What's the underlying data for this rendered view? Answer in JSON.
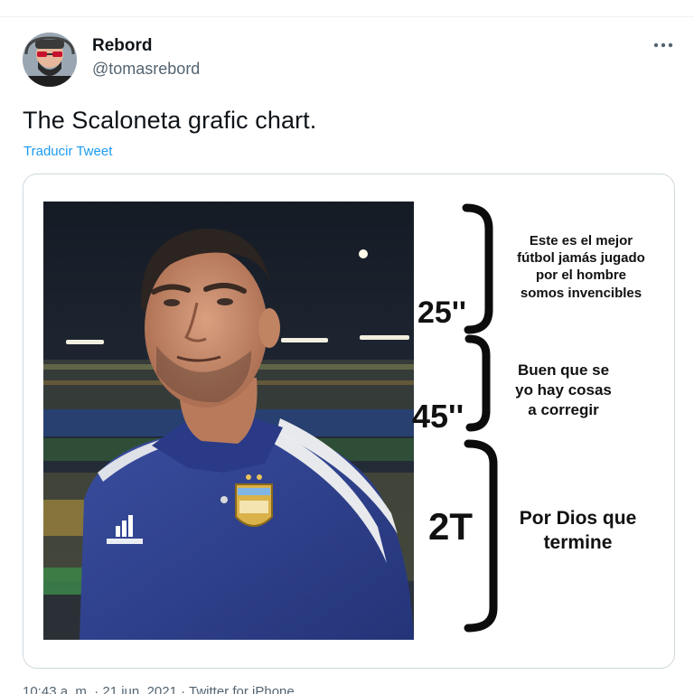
{
  "tweet": {
    "display_name": "Rebord",
    "handle": "@tomasrebord",
    "text": "The Scaloneta grafic chart.",
    "translate_label": "Traducir Tweet",
    "more_icon": "more-horizontal-icon",
    "footer": "10:43 a. m. · 21 jun. 2021 · Twitter for iPhone"
  },
  "meme": {
    "segments": [
      {
        "time": "25''",
        "caption": [
          "Este es el mejor",
          "fútbol jamás jugado",
          "por el hombre",
          "somos invencibles"
        ]
      },
      {
        "time": "45''",
        "caption": [
          "Buen que se",
          "yo hay cosas",
          "a corregir"
        ]
      },
      {
        "time": "2T",
        "caption": [
          "Por Dios que",
          "termine"
        ]
      }
    ]
  },
  "colors": {
    "link": "#1d9bf0",
    "secondary_text": "#536471",
    "jersey": "#2d3f8c",
    "stadium_bg": "#1b2230"
  }
}
